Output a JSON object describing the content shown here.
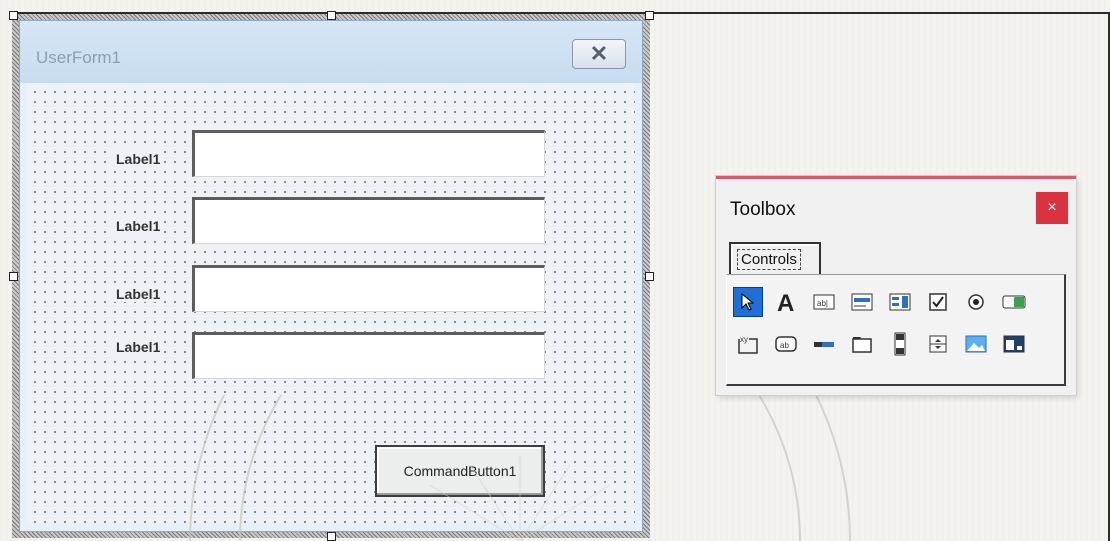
{
  "userform": {
    "title": "UserForm1",
    "close_glyph": "✕",
    "labels": [
      "Label1",
      "Label1",
      "Label1",
      "Label1"
    ],
    "command_button": "CommandButton1"
  },
  "toolbox": {
    "title": "Toolbox",
    "close_glyph": "×",
    "tab_label": "Controls",
    "tools_row1": [
      "select-objects-icon",
      "label-icon",
      "textbox-icon",
      "combobox-icon",
      "listbox-icon",
      "checkbox-icon",
      "optionbutton-icon",
      "togglebutton-icon"
    ],
    "tools_row2": [
      "frame-icon",
      "commandbutton-icon",
      "tabstrip-icon",
      "multipage-icon",
      "scrollbar-icon",
      "spinbutton-icon",
      "image-icon",
      "refedit-icon"
    ],
    "accent_color": "#d8333f",
    "selected_color": "#1f6fd6"
  }
}
